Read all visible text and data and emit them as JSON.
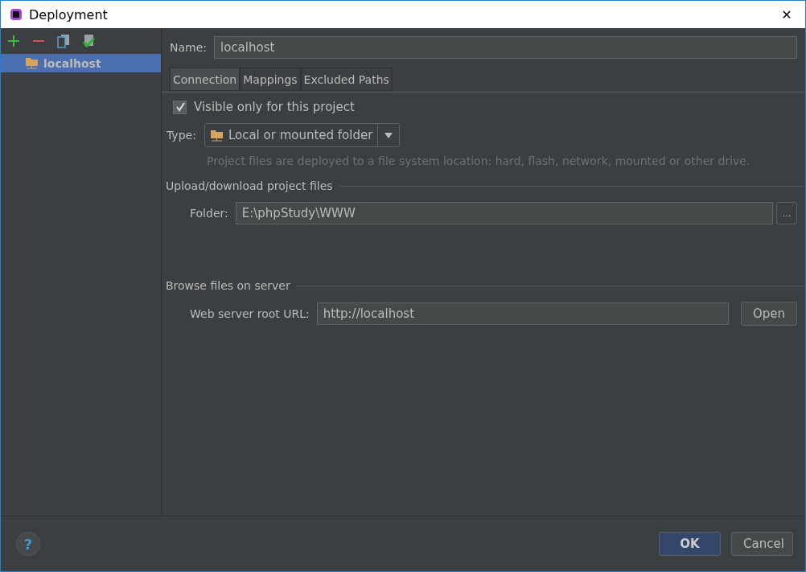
{
  "window": {
    "title": "Deployment",
    "close": "✕"
  },
  "sidebar": {
    "items": [
      {
        "label": "localhost",
        "selected": true
      }
    ]
  },
  "name_field": {
    "label": "Name:",
    "value": "localhost"
  },
  "tabs": [
    {
      "label": "Connection",
      "selected": true
    },
    {
      "label": "Mappings",
      "selected": false
    },
    {
      "label": "Excluded Paths",
      "selected": false
    }
  ],
  "visible_only": {
    "label": "Visible only for this project",
    "checked": true
  },
  "type_field": {
    "label": "Type:",
    "value": "Local or mounted folder",
    "hint": "Project files are deployed to a file system location: hard, flash, network, mounted or other drive."
  },
  "upload_section": {
    "title": "Upload/download project files",
    "folder_label": "Folder:",
    "folder_value": "E:\\phpStudy\\WWW",
    "browse": "..."
  },
  "browse_section": {
    "title": "Browse files on server",
    "url_label": "Web server root URL:",
    "url_value": "http://localhost",
    "open": "Open"
  },
  "footer": {
    "help": "?",
    "ok": "OK",
    "cancel": "Cancel"
  }
}
